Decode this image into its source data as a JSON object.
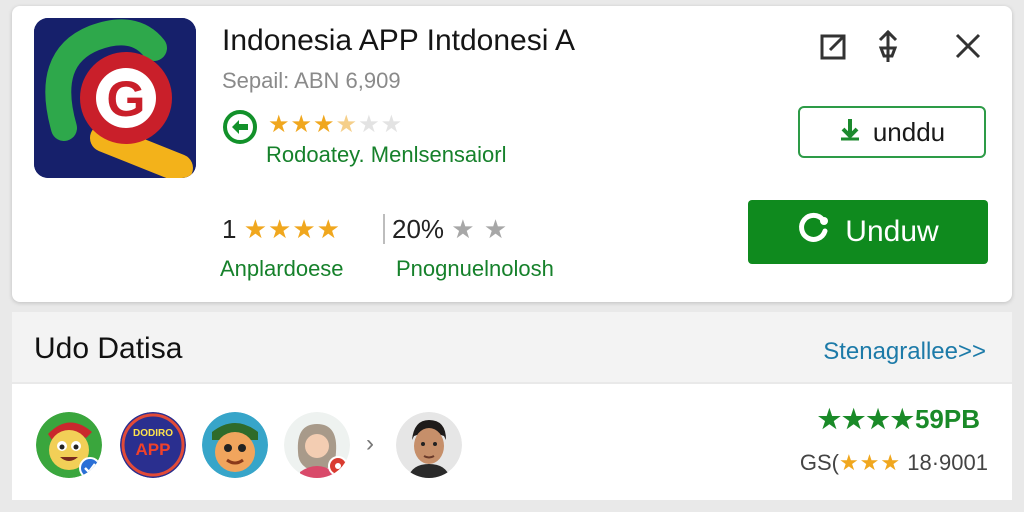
{
  "app": {
    "title": "Indonesia APP Intdonesi  A",
    "subtitle": "Sepail: ABN 6,909",
    "rating_stars": {
      "filled": "★★★",
      "half": "★",
      "empty": "★★"
    },
    "developer": "Rodoatey. Menlsensaiorl"
  },
  "header_actions": {
    "edit_icon": "square-pencil-icon",
    "pin_icon": "pin-icon",
    "close_icon": "close-icon"
  },
  "stats": [
    {
      "value": "1",
      "stars": "★★★★",
      "label": "Anplardoese"
    },
    {
      "value": "20%",
      "stars": "★ ★",
      "label": "Pnognuelnolosh"
    }
  ],
  "buttons": {
    "secondary_label": "unddu",
    "primary_label": "Unduw"
  },
  "section": {
    "title": "Udo Datisa",
    "see_all": "Stenagrallee",
    "see_all_chevrons": ">>"
  },
  "avatars_row": {
    "app2_line1": "DODIRO",
    "app2_line2": "APP",
    "chevron": "›"
  },
  "right_panel": {
    "rating_stars": "★★★★",
    "rating_value": "59PB",
    "meta_prefix": "GS(",
    "meta_stars": "★★★",
    "meta_value": "18·9001"
  },
  "colors": {
    "accent_green": "#0f8a1e",
    "link_blue": "#1c7aa8",
    "star_gold": "#f0a71e"
  }
}
